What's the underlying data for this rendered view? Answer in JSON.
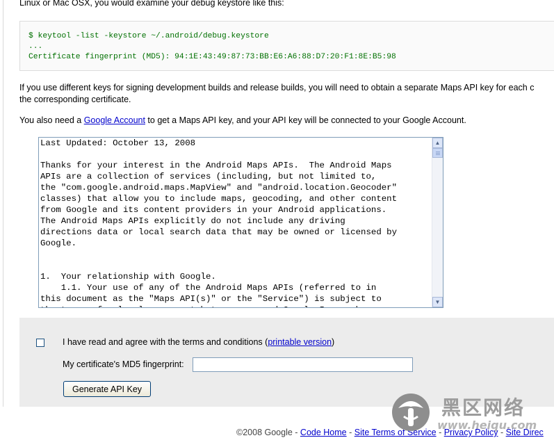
{
  "intro": {
    "text": "Linux or Mac OSX, you would examine your debug keystore like this:"
  },
  "code_example": {
    "lines": [
      "$ keytool -list -keystore ~/.android/debug.keystore",
      "...",
      "Certificate fingerprint (MD5): 94:1E:43:49:87:73:BB:E6:A6:88:D7:20:F1:8E:B5:98"
    ]
  },
  "paragraph_keys": {
    "line1": "If you use different keys for signing development builds and release builds, you will need to obtain a separate Maps API key for each c",
    "line2": "the corresponding certificate."
  },
  "paragraph_account": {
    "before": "You also need a ",
    "link": "Google Account",
    "after": " to get a Maps API key, and your API key will be connected to your Google Account."
  },
  "terms": {
    "text": "Last Updated: October 13, 2008\n\nThanks for your interest in the Android Maps APIs.  The Android Maps\nAPIs are a collection of services (including, but not limited to,\nthe \"com.google.android.maps.MapView\" and \"android.location.Geocoder\"\nclasses) that allow you to include maps, geocoding, and other content\nfrom Google and its content providers in your Android applications.\nThe Android Maps APIs explicitly do not include any driving\ndirections data or local search data that may be owned or licensed by\nGoogle.\n\n\n1.  Your relationship with Google.\n    1.1. Your use of any of the Android Maps APIs (referred to in\nthis document as the \"Maps API(s)\" or the \"Service\") is subject to\nthe terms of a legal agreement between you and Google Inc., whose",
    "scroll_up_icon": "arrow-up",
    "scroll_down_icon": "arrow-down"
  },
  "form": {
    "agree_label": "I have read and agree with the terms and conditions (",
    "printable_link": "printable version",
    "agree_close": ")",
    "agree_checked": false,
    "fingerprint_label": "My certificate's MD5 fingerprint:",
    "fingerprint_value": "",
    "generate_button": "Generate API Key"
  },
  "footer": {
    "copyright": "©2008 Google",
    "separator": " - ",
    "links": [
      "Code Home",
      "Site Terms of Service",
      "Privacy Policy",
      "Site Direc"
    ]
  },
  "watermark": {
    "chinese_text": "黑区网络",
    "url": "www.heiqu.com"
  },
  "colors": {
    "link": "#0000cc",
    "code_text": "#007000",
    "form_background": "#ececec"
  }
}
